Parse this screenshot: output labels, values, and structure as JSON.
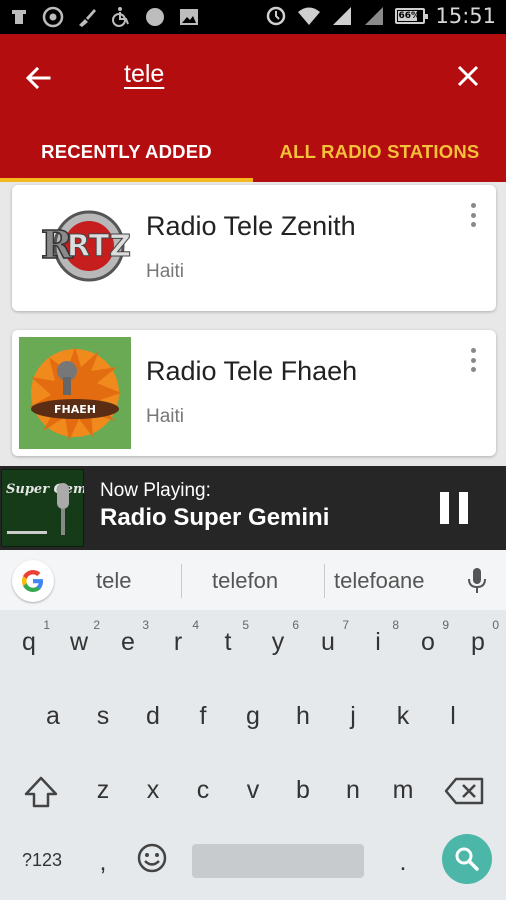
{
  "status_bar": {
    "time": "15:51",
    "battery": "66%",
    "left_icons": [
      "usb-icon",
      "chrome-icon",
      "brush-icon",
      "wheelchair-icon",
      "circle-icon",
      "image-icon"
    ],
    "right_icons": [
      "sync-icon",
      "wifi-icon",
      "signal-icon",
      "signal-icon"
    ]
  },
  "app_bar": {
    "search_query": "tele",
    "back_icon": "arrow-left-icon",
    "close_icon": "close-icon",
    "color": "#b40d10"
  },
  "tabs": [
    {
      "label": "RECENTLY ADDED",
      "active": true
    },
    {
      "label": "ALL RADIO STATIONS",
      "active": false
    }
  ],
  "stations": [
    {
      "name": "Radio Tele Zenith",
      "country": "Haiti",
      "logo_text": "RTZ"
    },
    {
      "name": "Radio Tele Fhaeh",
      "country": "Haiti",
      "logo_text": "FHAEH"
    }
  ],
  "now_playing": {
    "label": "Now Playing:",
    "title": "Radio Super Gemini",
    "art_text": "Super Gemini"
  },
  "keyboard": {
    "suggestions": [
      "tele",
      "telefon",
      "telefoane"
    ],
    "row1": [
      [
        "q",
        "1"
      ],
      [
        "w",
        "2"
      ],
      [
        "e",
        "3"
      ],
      [
        "r",
        "4"
      ],
      [
        "t",
        "5"
      ],
      [
        "y",
        "6"
      ],
      [
        "u",
        "7"
      ],
      [
        "i",
        "8"
      ],
      [
        "o",
        "9"
      ],
      [
        "p",
        "0"
      ]
    ],
    "row2": [
      "a",
      "s",
      "d",
      "f",
      "g",
      "h",
      "j",
      "k",
      "l"
    ],
    "row3": [
      "z",
      "x",
      "c",
      "v",
      "b",
      "n",
      "m"
    ],
    "row4": {
      "symbols": "?123",
      "comma": ",",
      "period": "."
    }
  },
  "colors": {
    "primary": "#b40d10",
    "accent": "#f5b81e",
    "search_key": "#4cb6a9"
  }
}
